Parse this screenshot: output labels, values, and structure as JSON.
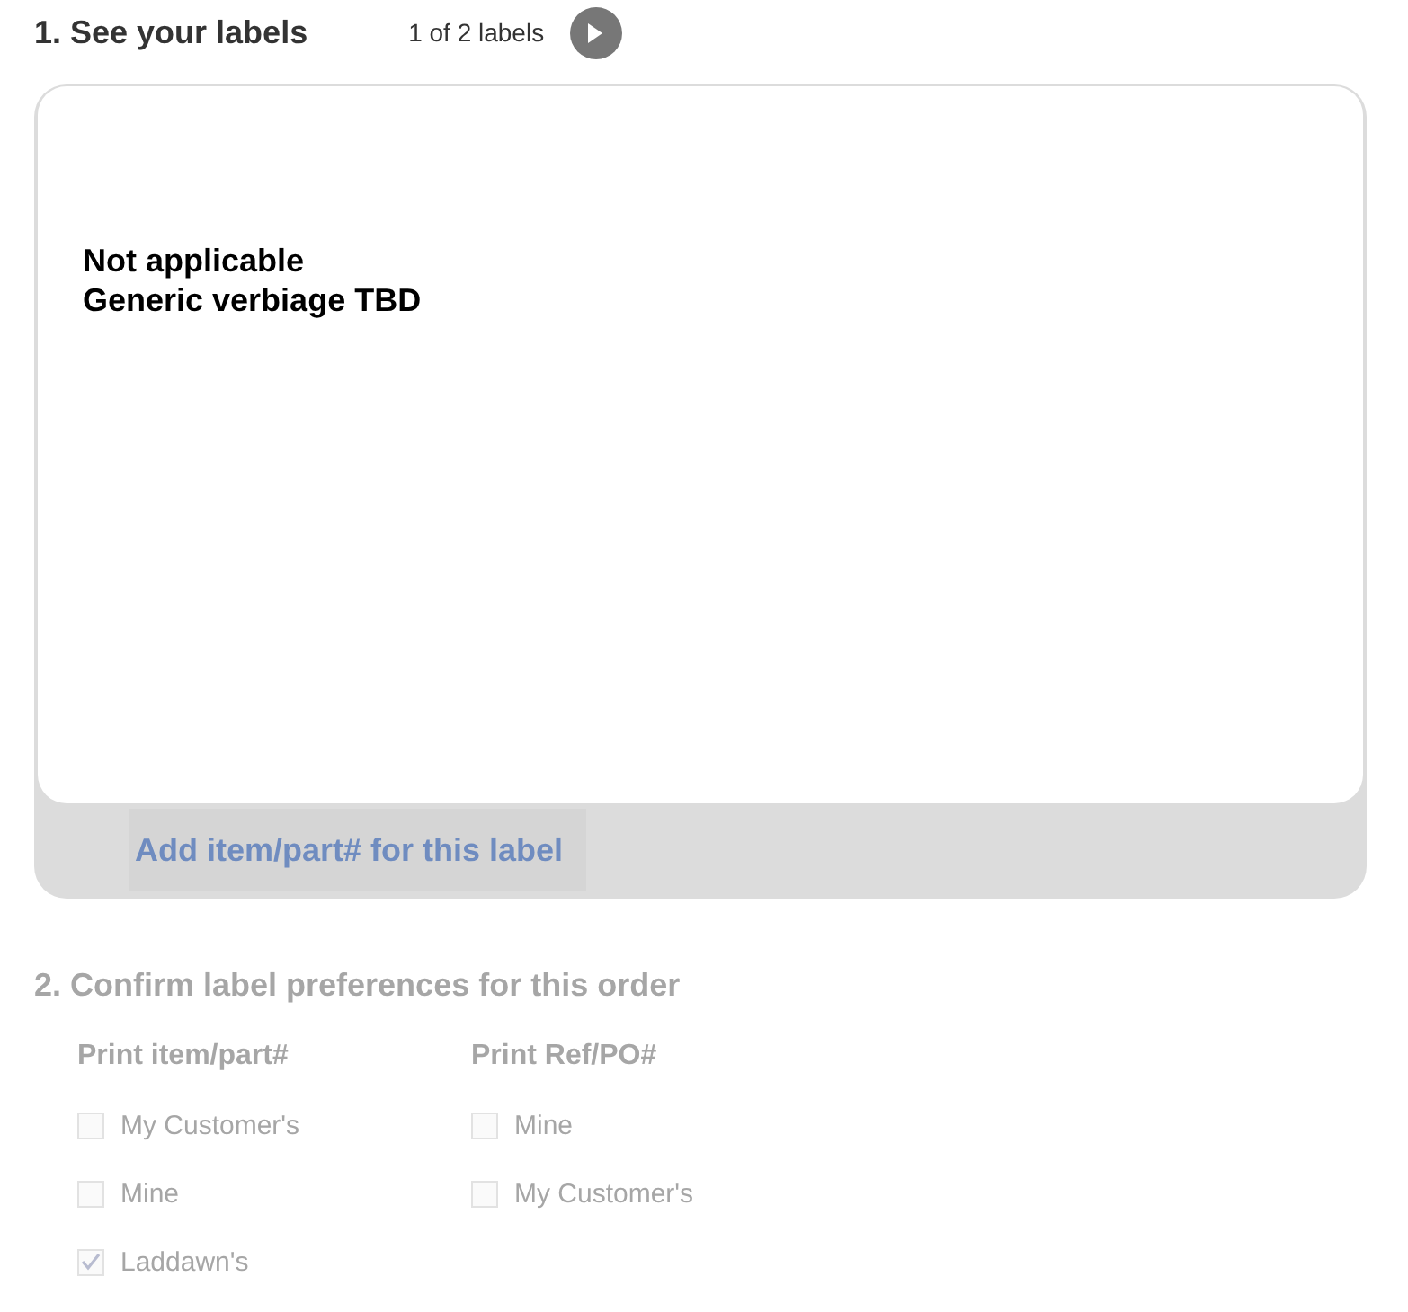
{
  "step1": {
    "title": "1. See your labels",
    "counter": "1 of 2 labels",
    "next_button": {
      "disabled": false
    },
    "label_preview": {
      "lines": [
        "Not applicable",
        "Generic verbiage TBD"
      ]
    },
    "add_button": {
      "label": "Add item/part# for this label",
      "disabled": true
    }
  },
  "step2": {
    "title": "2. Confirm label preferences for this order",
    "disabled": true,
    "groups": [
      {
        "heading": "Print item/part#",
        "options": [
          {
            "label": "My Customer's",
            "checked": false
          },
          {
            "label": "Mine",
            "checked": false
          },
          {
            "label": "Laddawn's",
            "checked": true
          }
        ]
      },
      {
        "heading": "Print Ref/PO#",
        "options": [
          {
            "label": "Mine",
            "checked": false
          },
          {
            "label": "My Customer's",
            "checked": false
          }
        ]
      }
    ]
  }
}
